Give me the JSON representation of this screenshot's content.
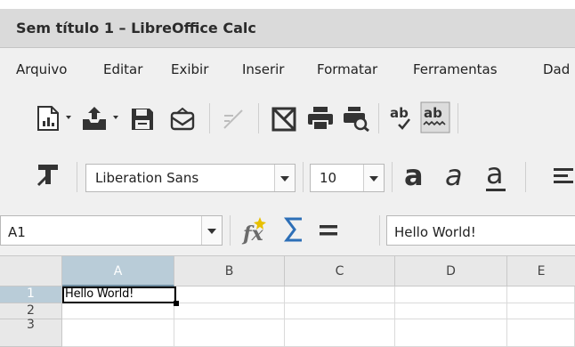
{
  "window": {
    "title": "Sem título 1 – LibreOffice Calc"
  },
  "menu": [
    {
      "label": "Arquivo"
    },
    {
      "label": "Editar"
    },
    {
      "label": "Exibir"
    },
    {
      "label": "Inserir"
    },
    {
      "label": "Formatar"
    },
    {
      "label": "Ferramentas"
    },
    {
      "label": "Dad"
    }
  ],
  "standard_toolbar": {
    "icons": [
      "new-spreadsheet-icon",
      "open-icon",
      "save-icon",
      "email-icon",
      "edit-mode-icon",
      "export-pdf-icon",
      "print-icon",
      "print-preview-icon",
      "spelling-icon",
      "autospell-icon"
    ]
  },
  "format_toolbar": {
    "font_name": "Liberation Sans",
    "font_size": "10",
    "icons": [
      "styles-icon",
      "bold-icon",
      "italic-icon",
      "underline-icon",
      "align-left-icon"
    ]
  },
  "formula_bar": {
    "name_box": "A1",
    "content": "Hello World!",
    "icons": [
      "function-wizard-icon",
      "sum-icon",
      "formula-icon"
    ]
  },
  "sheet": {
    "columns": [
      "A",
      "B",
      "C",
      "D",
      "E"
    ],
    "rows": [
      "1",
      "2",
      "3"
    ],
    "selected_cell": "A1",
    "cells": {
      "A1": "Hello World!"
    }
  },
  "colors": {
    "selection_header": "#b9ccd8",
    "titlebar": "#dadada",
    "toolbar": "#f0f0f0"
  }
}
